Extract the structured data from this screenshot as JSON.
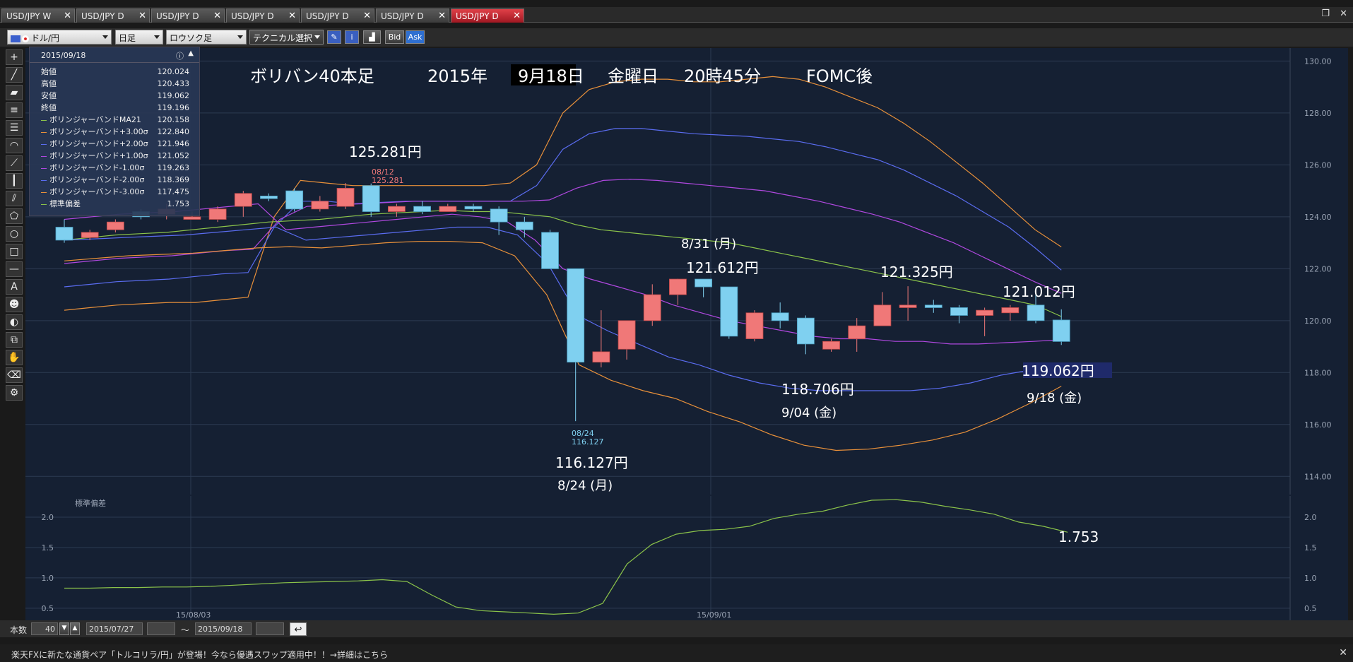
{
  "tabs": [
    {
      "label": "USD/JPY W",
      "active": false
    },
    {
      "label": "USD/JPY D",
      "active": false
    },
    {
      "label": "USD/JPY D",
      "active": false
    },
    {
      "label": "USD/JPY D",
      "active": false
    },
    {
      "label": "USD/JPY D",
      "active": false
    },
    {
      "label": "USD/JPY D",
      "active": false
    },
    {
      "label": "USD/JPY D",
      "active": true
    }
  ],
  "toolbar": {
    "pair": "ドル/円",
    "timeframe": "日足",
    "chart_type": "ロウソク足",
    "technical": "テクニカル選択",
    "bid": "Bid",
    "ask": "Ask"
  },
  "info_panel": {
    "date": "2015/09/18",
    "ohlc": [
      {
        "label": "始値",
        "value": "120.024"
      },
      {
        "label": "高値",
        "value": "120.433"
      },
      {
        "label": "安値",
        "value": "119.062"
      },
      {
        "label": "終値",
        "value": "119.196"
      }
    ],
    "bands": [
      {
        "label": "ボリンジャーバンドMA21",
        "value": "120.158",
        "color": "#8bc34a"
      },
      {
        "label": "ボリンジャーバンド+3.00σ",
        "value": "122.840",
        "color": "#e8903a"
      },
      {
        "label": "ボリンジャーバンド+2.00σ",
        "value": "121.946",
        "color": "#5a6cf0"
      },
      {
        "label": "ボリンジャーバンド+1.00σ",
        "value": "121.052",
        "color": "#b048e0"
      },
      {
        "label": "ボリンジャーバンド-1.00σ",
        "value": "119.263",
        "color": "#b048e0"
      },
      {
        "label": "ボリンジャーバンド-2.00σ",
        "value": "118.369",
        "color": "#5a6cf0"
      },
      {
        "label": "ボリンジャーバンド-3.00σ",
        "value": "117.475",
        "color": "#e8903a"
      },
      {
        "label": "標準偏差",
        "value": "1.753",
        "color": "#8bc34a"
      }
    ]
  },
  "annotations": {
    "headline_a": "ボリバン40本足",
    "headline_year": "2015年",
    "headline_date": "9月18日",
    "headline_day": "金曜日",
    "headline_time": "20時45分",
    "headline_event": "FOMC後",
    "a1": "125.281円",
    "a2": "8/31 (月)",
    "a3": "121.612円",
    "a4": "121.325円",
    "a5": "121.012円",
    "a6": "118.706円",
    "a7": "9/04 (金)",
    "a8": "119.062円",
    "a9": "9/18 (金)",
    "a10": "116.127円",
    "a11": "8/24 (月)",
    "a12": "1.753",
    "m1_date": "08/12",
    "m1_val": "125.281",
    "m2_date": "08/24",
    "m2_val": "116.127"
  },
  "chart_data": {
    "type": "candlestick",
    "ylim": [
      113.3,
      130.5
    ],
    "y_ticks": [
      "130.00",
      "128.00",
      "126.00",
      "124.00",
      "122.00",
      "120.00",
      "118.00",
      "116.00",
      "114.00"
    ],
    "x_labels": [
      "15/08/03",
      "15/09/01"
    ],
    "candles": [
      [
        123.6,
        123.9,
        123.0,
        123.1
      ],
      [
        123.2,
        123.5,
        123.1,
        123.4
      ],
      [
        123.5,
        123.9,
        123.4,
        123.8
      ],
      [
        124.2,
        124.3,
        123.9,
        124.0
      ],
      [
        124.1,
        124.5,
        123.9,
        124.3
      ],
      [
        123.9,
        124.2,
        123.9,
        124.0
      ],
      [
        123.9,
        124.4,
        123.8,
        124.3
      ],
      [
        124.4,
        125.0,
        124.0,
        124.9
      ],
      [
        124.8,
        124.9,
        124.6,
        124.7
      ],
      [
        125.0,
        125.1,
        124.2,
        124.3
      ],
      [
        124.3,
        124.8,
        124.2,
        124.6
      ],
      [
        124.4,
        125.3,
        124.3,
        125.1
      ],
      [
        125.2,
        125.281,
        124.0,
        124.2
      ],
      [
        124.2,
        124.5,
        124.0,
        124.4
      ],
      [
        124.4,
        124.6,
        124.1,
        124.2
      ],
      [
        124.2,
        124.5,
        124.2,
        124.4
      ],
      [
        124.4,
        124.5,
        124.2,
        124.3
      ],
      [
        124.3,
        124.4,
        123.3,
        123.8
      ],
      [
        123.8,
        124.0,
        123.2,
        123.5
      ],
      [
        123.4,
        123.5,
        122.0,
        122.0
      ],
      [
        122.0,
        122.0,
        116.127,
        118.4
      ],
      [
        118.4,
        120.4,
        118.2,
        118.8
      ],
      [
        118.9,
        120.0,
        118.5,
        120.0
      ],
      [
        120.0,
        121.4,
        119.8,
        121.0
      ],
      [
        121.0,
        121.612,
        120.6,
        121.6
      ],
      [
        121.6,
        121.6,
        120.9,
        121.3
      ],
      [
        121.3,
        121.3,
        119.3,
        119.4
      ],
      [
        119.3,
        120.4,
        119.2,
        120.3
      ],
      [
        120.3,
        120.7,
        119.7,
        120.0
      ],
      [
        120.1,
        120.2,
        118.706,
        119.1
      ],
      [
        118.9,
        119.3,
        118.8,
        119.2
      ],
      [
        119.3,
        120.1,
        118.8,
        119.8
      ],
      [
        119.8,
        121.1,
        119.8,
        120.6
      ],
      [
        120.5,
        121.325,
        120.0,
        120.6
      ],
      [
        120.6,
        120.8,
        120.3,
        120.5
      ],
      [
        120.5,
        120.6,
        119.9,
        120.2
      ],
      [
        120.2,
        120.5,
        119.4,
        120.4
      ],
      [
        120.3,
        120.6,
        120.0,
        120.5
      ],
      [
        120.6,
        121.012,
        119.9,
        120.0
      ],
      [
        120.024,
        120.433,
        119.062,
        119.196
      ]
    ],
    "ma21": [
      123.1,
      123.2,
      123.3,
      123.35,
      123.4,
      123.5,
      123.6,
      123.7,
      123.8,
      123.85,
      123.9,
      124.0,
      124.1,
      124.15,
      124.2,
      124.25,
      124.2,
      124.2,
      124.1,
      124.0,
      123.7,
      123.5,
      123.4,
      123.3,
      123.2,
      123.1,
      123.0,
      122.8,
      122.6,
      122.4,
      122.2,
      122.0,
      121.8,
      121.6,
      121.4,
      121.2,
      121.0,
      120.8,
      120.6,
      120.158
    ],
    "upper3": [
      120.4,
      120.5,
      120.6,
      120.65,
      120.7,
      120.7,
      120.8,
      120.9,
      124.0,
      125.4,
      125.3,
      125.2,
      125.2,
      125.2,
      125.2,
      125.2,
      125.2,
      125.3,
      126.0,
      128.0,
      128.9,
      129.2,
      129.3,
      129.3,
      129.2,
      129.2,
      129.3,
      129.4,
      129.3,
      129.0,
      128.6,
      128.2,
      127.6,
      126.9,
      126.1,
      125.3,
      124.4,
      123.5,
      122.84
    ],
    "upper2": [
      121.3,
      121.4,
      121.5,
      121.55,
      121.6,
      121.7,
      121.8,
      121.85,
      123.6,
      124.6,
      124.6,
      124.5,
      124.55,
      124.6,
      124.6,
      124.6,
      124.6,
      124.6,
      125.2,
      126.6,
      127.2,
      127.4,
      127.4,
      127.3,
      127.2,
      127.15,
      127.1,
      127.0,
      126.9,
      126.7,
      126.45,
      126.2,
      125.8,
      125.3,
      124.8,
      124.2,
      123.6,
      122.8,
      121.946
    ],
    "upper1": [
      122.2,
      122.3,
      122.4,
      122.45,
      122.5,
      122.6,
      122.7,
      122.75,
      123.9,
      124.4,
      124.45,
      124.5,
      124.55,
      124.6,
      124.6,
      124.6,
      124.6,
      124.6,
      124.65,
      125.1,
      125.4,
      125.45,
      125.4,
      125.3,
      125.2,
      125.1,
      125.0,
      124.8,
      124.6,
      124.35,
      124.1,
      123.8,
      123.4,
      123.0,
      122.5,
      122.0,
      121.5,
      121.052
    ],
    "lower1": [
      123.9,
      124.0,
      124.1,
      124.15,
      124.2,
      124.3,
      124.4,
      124.5,
      123.5,
      123.6,
      123.7,
      123.8,
      123.9,
      124.0,
      124.1,
      124.0,
      123.8,
      123.1,
      122.0,
      121.6,
      121.3,
      121.0,
      120.6,
      120.3,
      120.0,
      119.8,
      119.6,
      119.4,
      119.3,
      119.3,
      119.2,
      119.2,
      119.1,
      119.1,
      119.15,
      119.2,
      119.263
    ],
    "lower2": [
      123.1,
      123.15,
      123.2,
      123.25,
      123.3,
      123.4,
      123.5,
      123.6,
      123.1,
      123.2,
      123.3,
      123.4,
      123.5,
      123.6,
      123.6,
      123.3,
      122.2,
      120.2,
      119.6,
      119.1,
      118.6,
      118.3,
      117.9,
      117.6,
      117.4,
      117.3,
      117.3,
      117.3,
      117.3,
      117.4,
      117.6,
      117.9,
      118.1,
      118.369
    ],
    "lower3": [
      122.3,
      122.4,
      122.5,
      122.55,
      122.6,
      122.7,
      122.8,
      122.85,
      122.8,
      122.9,
      123.0,
      123.05,
      123.05,
      123.0,
      122.5,
      121.0,
      118.3,
      117.7,
      117.3,
      117.0,
      116.5,
      116.1,
      115.6,
      115.2,
      115.0,
      115.05,
      115.2,
      115.4,
      115.7,
      116.2,
      116.8,
      117.475
    ],
    "sub": {
      "title": "標準偏差",
      "ylim": [
        0.3,
        2.35
      ],
      "y_ticks": [
        "2.0",
        "1.5",
        "1.0",
        "0.5"
      ],
      "values": [
        0.83,
        0.83,
        0.84,
        0.84,
        0.85,
        0.85,
        0.86,
        0.88,
        0.9,
        0.92,
        0.93,
        0.94,
        0.95,
        0.97,
        0.94,
        0.72,
        0.52,
        0.46,
        0.44,
        0.42,
        0.4,
        0.42,
        0.58,
        1.23,
        1.55,
        1.72,
        1.78,
        1.8,
        1.85,
        1.98,
        2.05,
        2.1,
        2.2,
        2.28,
        2.29,
        2.25,
        2.18,
        2.12,
        2.05,
        1.92,
        1.85,
        1.753
      ]
    }
  },
  "bottom": {
    "count_label": "本数",
    "count_value": "40",
    "date_from": "2015/07/27",
    "tilde": "〜",
    "date_to": "2015/09/18"
  },
  "status": "楽天FXに新たな通貨ペア「トルコリラ/円」が登場！今なら優遇スワップ適用中！！→詳細はこちら"
}
